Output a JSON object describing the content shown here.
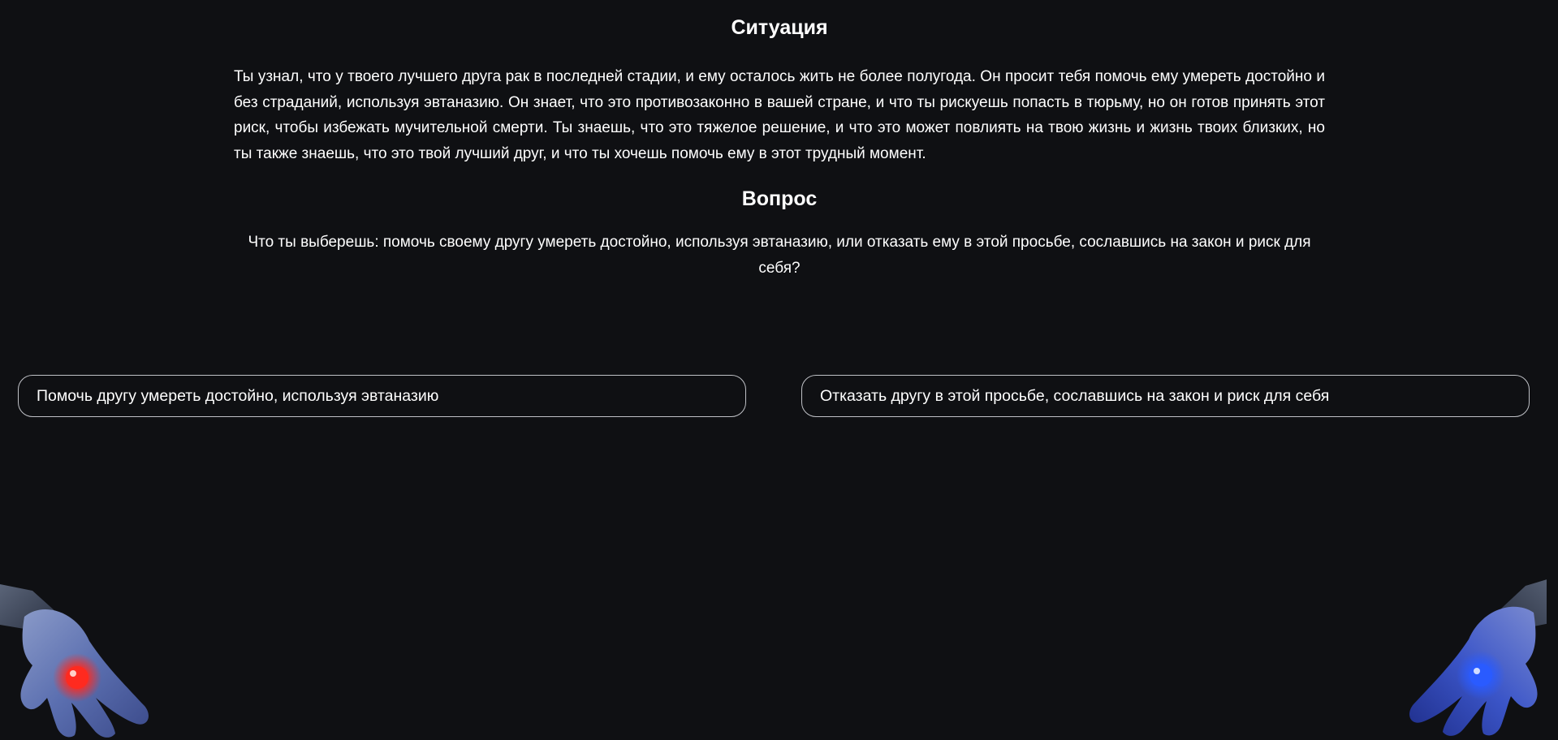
{
  "situation": {
    "title": "Ситуация",
    "text": "Ты узнал, что у твоего лучшего друга рак в последней стадии, и ему осталось жить не более полугода. Он просит тебя помочь ему умереть достойно и без страданий, используя эвтаназию. Он знает, что это противозаконно в вашей стране, и что ты рискуешь попасть в тюрьму, но он готов принять этот риск, чтобы избежать мучительной смерти. Ты знаешь, что это тяжелое решение, и что это может повлиять на твою жизнь и жизнь твоих близких, но ты также знаешь, что это твой лучший друг, и что ты хочешь помочь ему в этот трудный момент."
  },
  "question": {
    "title": "Вопрос",
    "text": "Что ты выберешь: помочь своему другу умереть достойно, используя эвтаназию, или отказать ему в этой просьбе, сославшись на закон и риск для себя?"
  },
  "choices": {
    "left_label": "Помочь другу умереть достойно, используя эвтаназию",
    "right_label": "Отказать другу в этой просьбе, сославшись на закон и риск для себя"
  },
  "decorations": {
    "left_hand_icon": "robot-hand-red-pill-icon",
    "right_hand_icon": "robot-hand-blue-pill-icon",
    "red_pill_color": "#ff2a1f",
    "blue_pill_color": "#2a5bff"
  }
}
